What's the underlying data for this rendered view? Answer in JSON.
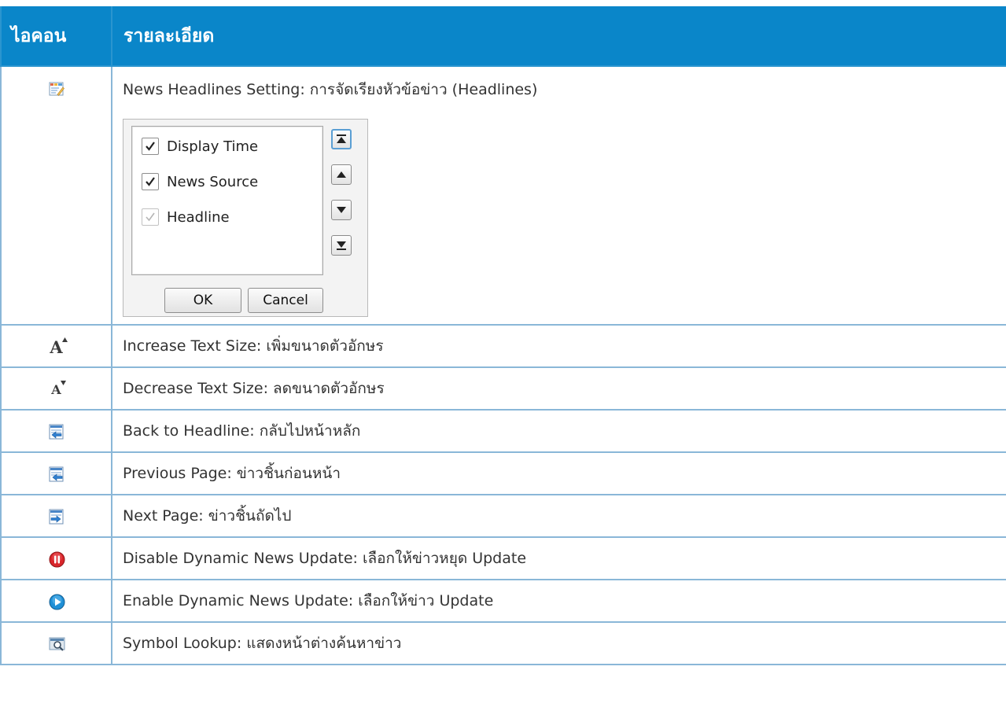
{
  "header": {
    "icon_col": "ไอคอน",
    "desc_col": "รายละเอียด"
  },
  "rows": [
    {
      "icon": "headline-setting-icon",
      "text": "News Headlines Setting: การจัดเรียงหัวข้อข่าว (Headlines)"
    },
    {
      "icon": "increase-text-icon",
      "text": "Increase Text Size: เพิ่มขนาดตัวอักษร"
    },
    {
      "icon": "decrease-text-icon",
      "text": "Decrease Text Size: ลดขนาดตัวอักษร"
    },
    {
      "icon": "back-to-headline-icon",
      "text": "Back to Headline: กลับไปหน้าหลัก"
    },
    {
      "icon": "previous-page-icon",
      "text": "Previous Page: ข่าวชิ้นก่อนหน้า"
    },
    {
      "icon": "next-page-icon",
      "text": "Next Page: ข่าวชิ้นถัดไป"
    },
    {
      "icon": "pause-update-icon",
      "text": "Disable Dynamic News Update: เลือกให้ข่าวหยุด Update"
    },
    {
      "icon": "play-update-icon",
      "text": "Enable Dynamic News Update: เลือกให้ข่าว Update"
    },
    {
      "icon": "symbol-lookup-icon",
      "text": "Symbol Lookup: แสดงหน้าต่างค้นหาข่าว"
    }
  ],
  "increase_glyph": "A",
  "decrease_glyph": "A",
  "dialog": {
    "options": [
      {
        "label": "Display Time",
        "checked": true,
        "enabled": true
      },
      {
        "label": "News Source",
        "checked": true,
        "enabled": true
      },
      {
        "label": "Headline",
        "checked": true,
        "enabled": false
      }
    ],
    "arrow_buttons": [
      "move-top-icon",
      "move-up-icon",
      "move-down-icon",
      "move-bottom-icon"
    ],
    "ok_label": "OK",
    "cancel_label": "Cancel"
  },
  "colors": {
    "header_bg": "#0a86c9",
    "border": "#8ab7d8",
    "pause_red": "#d9262b",
    "play_blue": "#1f8fd6"
  }
}
